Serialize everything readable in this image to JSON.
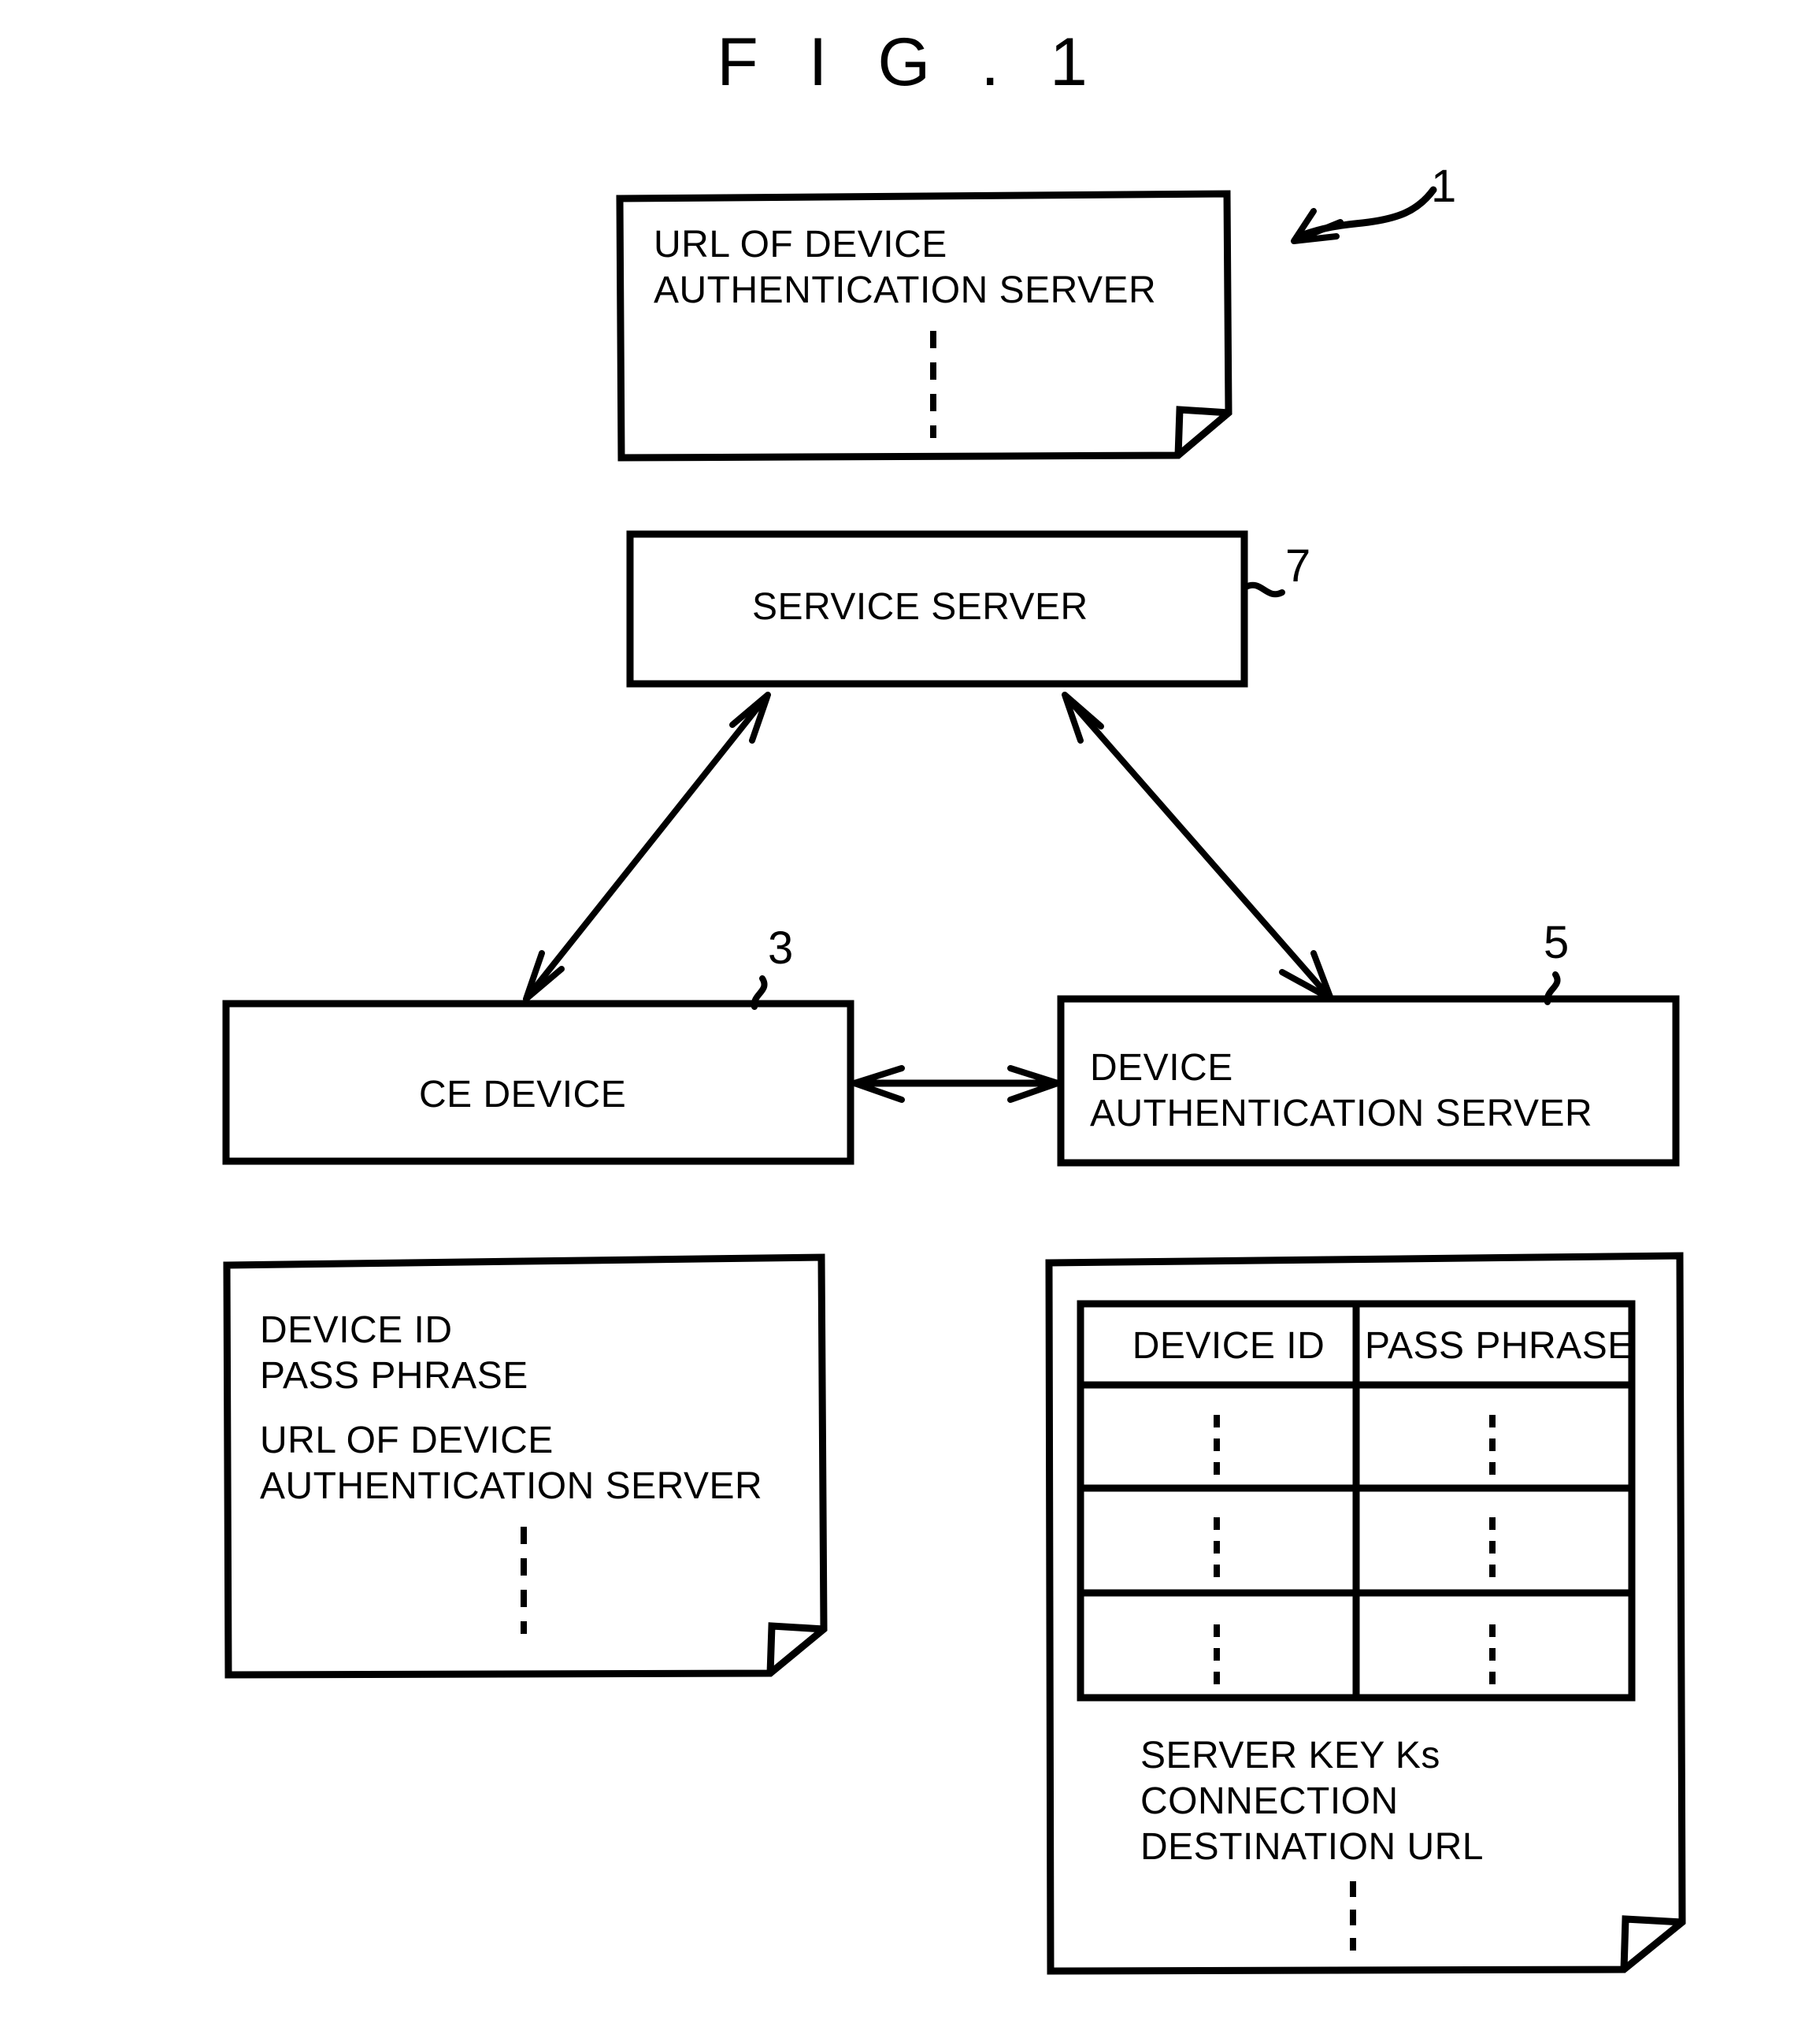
{
  "figure": {
    "title": "F I G . 1",
    "type": "patent-block-diagram"
  },
  "nodes": {
    "top_document": {
      "name": "url-of-device-authentication-server-document",
      "shape": "document-folded-corner",
      "lines": [
        "URL OF DEVICE",
        "AUTHENTICATION SERVER"
      ],
      "ellipsis": "vertical-dots"
    },
    "service_server": {
      "name": "service-server-box",
      "shape": "rectangle",
      "label": "SERVICE SERVER",
      "reference_numeral": "7"
    },
    "ce_device": {
      "name": "ce-device-box",
      "shape": "rectangle",
      "label": "CE DEVICE",
      "reference_numeral": "3"
    },
    "device_authentication_server": {
      "name": "device-authentication-server-box",
      "shape": "rectangle",
      "lines": [
        "DEVICE",
        "AUTHENTICATION SERVER"
      ],
      "reference_numeral": "5"
    },
    "ce_device_storage": {
      "name": "ce-device-storage-document",
      "shape": "document-folded-corner",
      "group_a": [
        "DEVICE ID",
        "PASS PHRASE"
      ],
      "group_b": [
        "URL OF DEVICE",
        "AUTHENTICATION SERVER"
      ],
      "ellipsis": "vertical-dots"
    },
    "das_storage": {
      "name": "device-authentication-server-storage-document",
      "shape": "document-folded-corner",
      "table": {
        "headers": [
          "DEVICE ID",
          "PASS PHRASE"
        ],
        "rows": [
          [
            "⋮",
            "⋮"
          ],
          [
            "⋮",
            "⋮"
          ],
          [
            "⋮",
            "⋮"
          ]
        ]
      },
      "lines": [
        "SERVER KEY Ks",
        "CONNECTION",
        "DESTINATION URL"
      ],
      "ellipsis": "vertical-dots"
    }
  },
  "reference_numerals": {
    "system": "1",
    "service_server": "7",
    "ce_device": "3",
    "device_authentication_server": "5"
  },
  "connectors": [
    {
      "name": "service-server-to-ce-device",
      "from": "service_server",
      "to": "ce_device",
      "style": "double-headed-diagonal-arrow"
    },
    {
      "name": "service-server-to-device-authentication-server",
      "from": "service_server",
      "to": "device_authentication_server",
      "style": "double-headed-diagonal-arrow"
    },
    {
      "name": "ce-device-to-device-authentication-server",
      "from": "ce_device",
      "to": "device_authentication_server",
      "style": "double-headed-horizontal-arrow"
    },
    {
      "name": "system-pointer",
      "from": "reference_numerals.system",
      "to": "diagram",
      "style": "curved-leader-arrow"
    }
  ],
  "colors": {
    "ink": "#000000",
    "paper": "#ffffff"
  }
}
